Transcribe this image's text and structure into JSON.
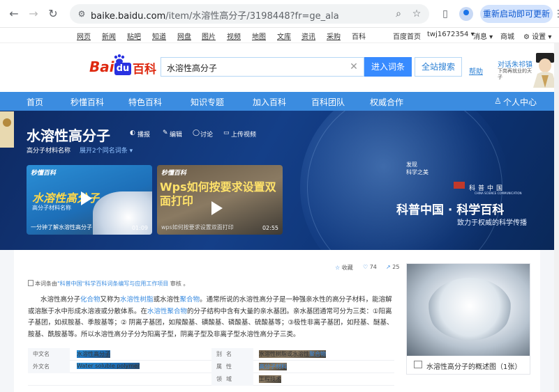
{
  "browser": {
    "url_host": "baike.baidu.com",
    "url_path": "/item/水溶性高分子/3198448?fr=ge_ala",
    "restart_label": "重新启动即可更新"
  },
  "topnav": {
    "items": [
      "网页",
      "新闻",
      "贴吧",
      "知道",
      "网盘",
      "图片",
      "视频",
      "地图",
      "文库",
      "资讯",
      "采购",
      "百科"
    ],
    "right": [
      "百度首页",
      "twj1672354 ▾",
      "消息 ▾",
      "商城",
      "⚙ 设置 ▾"
    ]
  },
  "header": {
    "logo_text": "Bai",
    "logo_du": "du",
    "logo_baike": "百科",
    "search_value": "水溶性高分子",
    "enter_label": "进入词条",
    "all_label": "全站搜索",
    "help_label": "帮助",
    "promo_title": "对话朱祁镇",
    "promo_sub": "下岗再就业的天子"
  },
  "bluenav": {
    "items": [
      "首页",
      "秒懂百科",
      "特色百科",
      "知识专题",
      "加入百科",
      "百科团队",
      "权威合作"
    ],
    "user_center": "个人中心"
  },
  "banner": {
    "title": "水溶性高分子",
    "actions": [
      "播报",
      "编辑",
      "讨论",
      "上传视频"
    ],
    "subtitle": "高分子材料名称",
    "expand": "展开2个同名词条 ▾",
    "videos": [
      {
        "brand": "秒懂百科",
        "big": "水溶性高分子",
        "small": "高分子材料名称",
        "caption": "一分钟了解水溶性高分子",
        "duration": "01:09"
      },
      {
        "brand": "秒懂百科",
        "big": "Wps如何按要求设置双面打印",
        "caption": "wps如何按要求设置双面打印",
        "duration": "02:55"
      }
    ],
    "discover": "发现",
    "discover_sub": "科学之美",
    "kp_logo": "科普中国",
    "kp_sub": "CHINA SCIENCE COMMUNICATION",
    "kp_title": "科普中国 · 科学百科",
    "kp_slogan": "致力于权威的科学传播"
  },
  "toolbar": {
    "collect": "收藏",
    "likes": "74",
    "shares": "25"
  },
  "notice": {
    "prefix": "本词条由",
    "link": "\"科普中国\"科学百科词条编写与应用工作项目",
    "suffix": " 审核 。"
  },
  "paragraph": {
    "t1": "水溶性高分子",
    "l1": "化合物",
    "t2": "又称为",
    "l2": "水溶性树脂",
    "t3": "或水溶性",
    "l3": "聚合物",
    "t4": "。通常所说的水溶性高分子是一种强亲水性的高分子材料，能溶解或溶胀于水中形成水溶液或分散体系。在",
    "l4": "水溶性聚合物",
    "t5": "的分子结构中含有大量的亲水基团。亲水基团通常可分为三类：①阳离子基团，如叔胺基、季胺基等；② 阴离子基团，如羧酸基、磺酸基、磷酸基、硫酸基等；③极性非离子基团，如羟基、醚基、胺基、酰胺基等。所以水溶性高分子分为阳离子型，阴离子型及非离子型水溶性高分子三类。"
  },
  "infobox": {
    "rows": [
      {
        "k1": "中文名",
        "v1": "水溶性高分子",
        "k2": "别名",
        "v2a": "水溶性树脂或水溶性",
        "v2b": "聚合物"
      },
      {
        "k1": "外文名",
        "v1": "Water soluble polymer",
        "k2": "属性",
        "v2a": "",
        "v2b": "高分子材料"
      },
      {
        "k1": "",
        "v1": "",
        "k2": "领域",
        "v2a": "工程技术",
        "v2b": ""
      }
    ]
  },
  "summary_image": {
    "caption": "水溶性高分子的概述图（1张）"
  }
}
